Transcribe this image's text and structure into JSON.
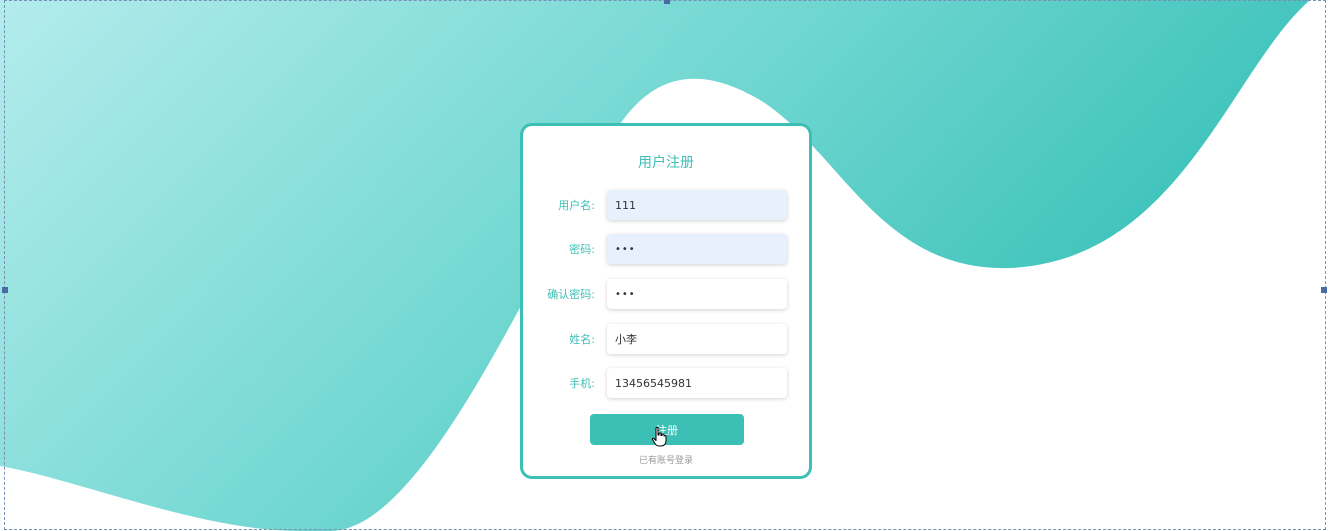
{
  "colors": {
    "accent": "#3cbfb5",
    "wave_light": "#b3ecec",
    "wave_dark": "#33bfb6",
    "autofill": "#e8f0fe",
    "link": "#999999"
  },
  "form": {
    "title": "用户注册",
    "fields": [
      {
        "label": "用户名:",
        "value": "111",
        "type": "text",
        "autofill": true
      },
      {
        "label": "密码:",
        "value": "111",
        "type": "password",
        "autofill": true
      },
      {
        "label": "确认密码:",
        "value": "111",
        "type": "password",
        "autofill": false
      },
      {
        "label": "姓名:",
        "value": "小李",
        "type": "text",
        "autofill": false
      },
      {
        "label": "手机:",
        "value": "13456545981",
        "type": "text",
        "autofill": false
      }
    ],
    "submit_label": "注册",
    "login_link": "已有账号登录"
  },
  "icons": {
    "cursor": "hand-pointer-icon"
  }
}
